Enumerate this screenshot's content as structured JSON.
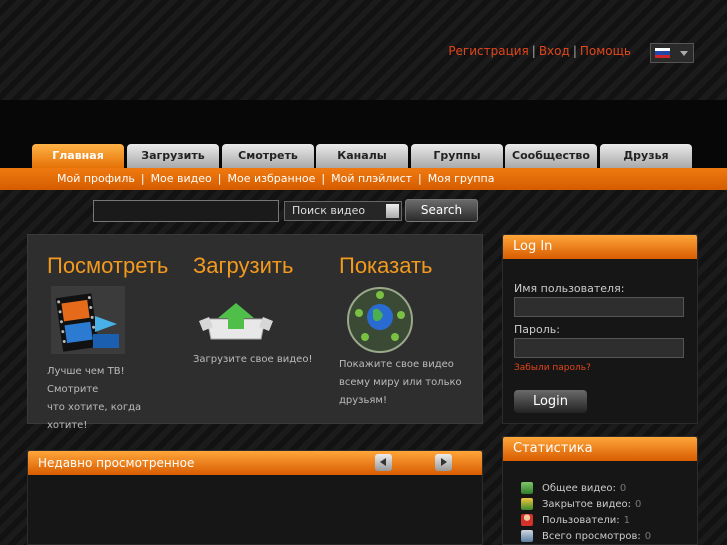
{
  "top_links": {
    "register": "Регистрация",
    "login": "Вход",
    "help": "Помощь",
    "separator": "|"
  },
  "language": {
    "selected_flag": "russian-flag-icon"
  },
  "tabs": [
    {
      "label": "Главная",
      "active": true
    },
    {
      "label": "Загрузить",
      "active": false
    },
    {
      "label": "Смотреть",
      "active": false
    },
    {
      "label": "Каналы",
      "active": false
    },
    {
      "label": "Группы",
      "active": false
    },
    {
      "label": "Сообщество",
      "active": false
    },
    {
      "label": "Друзья",
      "active": false
    }
  ],
  "subnav": [
    "Мой профиль",
    "Мое видео",
    "Мое избранное",
    "Мой плэйлист",
    "Моя группа"
  ],
  "search": {
    "input_value": "",
    "select_value": "Поиск видео",
    "button_label": "Search"
  },
  "promo": [
    {
      "title": "Посмотреть",
      "icon": "film-strip-icon",
      "text_lines": [
        "Лучше чем ТВ! Смотрите",
        "что хотите, когда хотите!"
      ]
    },
    {
      "title": "Загрузить",
      "icon": "upload-box-icon",
      "text_lines": [
        "Загрузите свое видео!"
      ]
    },
    {
      "title": "Показать",
      "icon": "globe-share-icon",
      "text_lines": [
        "Покажите свое видео",
        "всему миру или только",
        "друзьям!"
      ]
    }
  ],
  "login": {
    "title": "Log In",
    "username_label": "Имя пользователя:",
    "password_label": "Пароль:",
    "forgot_label": "Забыли пароль?",
    "button_label": "Login"
  },
  "recent": {
    "title": "Недавно просмотренное"
  },
  "stats": {
    "title": "Статистика",
    "rows": [
      {
        "label": "Общее видео:",
        "value": "0",
        "icon": "video-stack-icon"
      },
      {
        "label": "Закрытое видео:",
        "value": "0",
        "icon": "private-video-icon"
      },
      {
        "label": "Пользователи:",
        "value": "1",
        "icon": "users-icon"
      },
      {
        "label": "Всего просмотров:",
        "value": "0",
        "icon": "monitor-icon"
      }
    ]
  },
  "colors": {
    "accent": "#f39a1e",
    "orange_bar": "#e46a00",
    "link_red": "#e2461b"
  }
}
